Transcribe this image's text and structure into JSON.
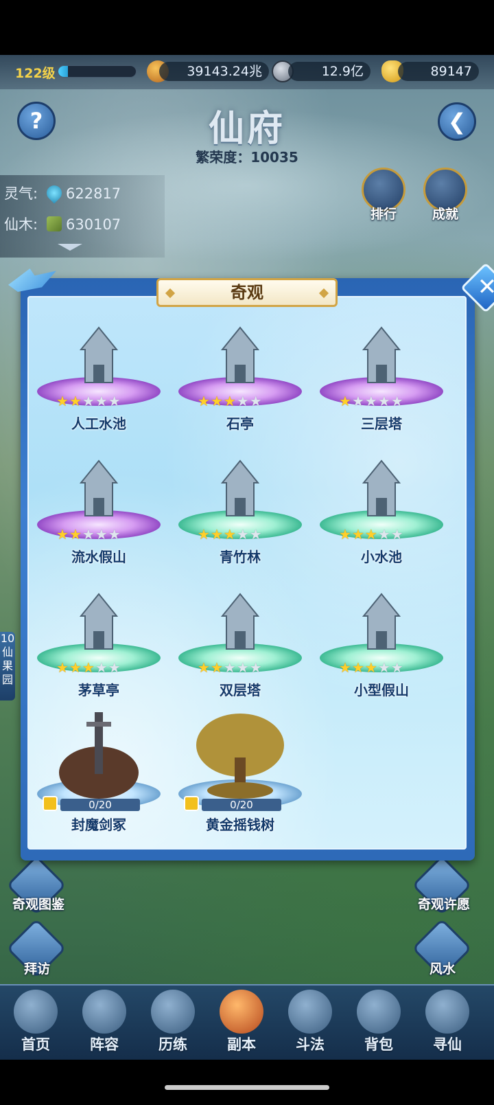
{
  "topbar": {
    "level": "122级",
    "xp_fraction": 0.12,
    "power": "39143.24兆",
    "coins": "12.9亿",
    "ingots": "89147"
  },
  "header": {
    "title": "仙府",
    "prosperity": "繁荣度：10035"
  },
  "resources": [
    {
      "label": "灵气:",
      "value": "622817",
      "icon": "spirit-drop-icon"
    },
    {
      "label": "仙木:",
      "value": "630107",
      "icon": "wood-log-icon"
    }
  ],
  "right_buttons": {
    "rank": "排行",
    "achievement": "成就"
  },
  "side_buttons": {
    "codex": "奇观图鉴",
    "wish": "奇观许愿",
    "visit": "拜访",
    "fengshui": "风水"
  },
  "side_tab": {
    "text": "10仙果园"
  },
  "modal": {
    "title": "奇观",
    "items": [
      {
        "name": "人工水池",
        "stars": 2,
        "max_stars": 5,
        "pedestal": "purple"
      },
      {
        "name": "石亭",
        "stars": 3,
        "max_stars": 5,
        "pedestal": "purple"
      },
      {
        "name": "三层塔",
        "stars": 1,
        "max_stars": 5,
        "pedestal": "purple"
      },
      {
        "name": "流水假山",
        "stars": 2,
        "max_stars": 5,
        "pedestal": "purple"
      },
      {
        "name": "青竹林",
        "stars": 3,
        "max_stars": 5,
        "pedestal": "green"
      },
      {
        "name": "小水池",
        "stars": 3,
        "max_stars": 5,
        "pedestal": "green"
      },
      {
        "name": "茅草亭",
        "stars": 3,
        "max_stars": 5,
        "pedestal": "green"
      },
      {
        "name": "双层塔",
        "stars": 2,
        "max_stars": 5,
        "pedestal": "green"
      },
      {
        "name": "小型假山",
        "stars": 3,
        "max_stars": 5,
        "pedestal": "green"
      },
      {
        "name": "封魔剑冢",
        "progress": "0/20",
        "locked": true
      },
      {
        "name": "黄金摇钱树",
        "progress": "0/20",
        "locked": true
      }
    ]
  },
  "nav": [
    {
      "label": "首页"
    },
    {
      "label": "阵容"
    },
    {
      "label": "历练"
    },
    {
      "label": "副本"
    },
    {
      "label": "斗法"
    },
    {
      "label": "背包"
    },
    {
      "label": "寻仙"
    }
  ]
}
